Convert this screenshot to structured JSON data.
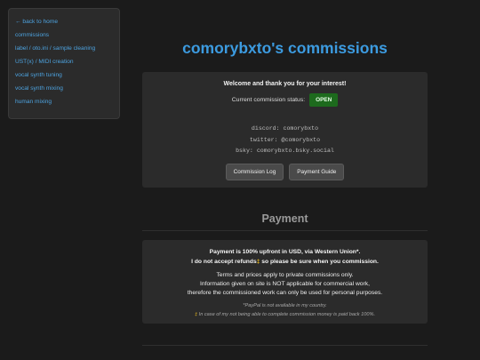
{
  "sidebar": {
    "items": [
      {
        "label": "← back to home"
      },
      {
        "label": "commissions"
      },
      {
        "label": "label / oto.ini / sample cleaning"
      },
      {
        "label": "UST(x) / MIDI creation"
      },
      {
        "label": "vocal synth tuning"
      },
      {
        "label": "vocal synth mixing"
      },
      {
        "label": "human mixing"
      }
    ]
  },
  "header": {
    "title": "comorybxto's commissions"
  },
  "intro": {
    "welcome": "Welcome and thank you for your interest!",
    "status_label": "Current commission status:",
    "status_value": "OPEN",
    "contacts": [
      "discord: comorybxto",
      "twitter: @comorybxto",
      "bsky: comorybxto.bsky.social"
    ],
    "buttons": {
      "log": "Commission Log",
      "guide": "Payment Guide"
    }
  },
  "payment": {
    "title": "Payment",
    "line1": "Payment is 100% upfront in USD, via Western Union*.",
    "line2_a": "I do not accept refunds",
    "dagger": "‡",
    "line2_b": " so please be sure when you commission.",
    "line3": "Terms and prices apply to private commissions only.",
    "line4": "Information given on site is NOT applicable for commercial work,",
    "line5": "therefore the commissioned work can only be used for personal purposes.",
    "note1": "*PayPal is not available in my country.",
    "note2": " In case of my not being able to complete commission money is paid back 100%."
  },
  "colors": {
    "accent": "#3c9be0",
    "link": "#4da3e0",
    "open": "#1d6a1d",
    "dagger": "#e8b820"
  }
}
